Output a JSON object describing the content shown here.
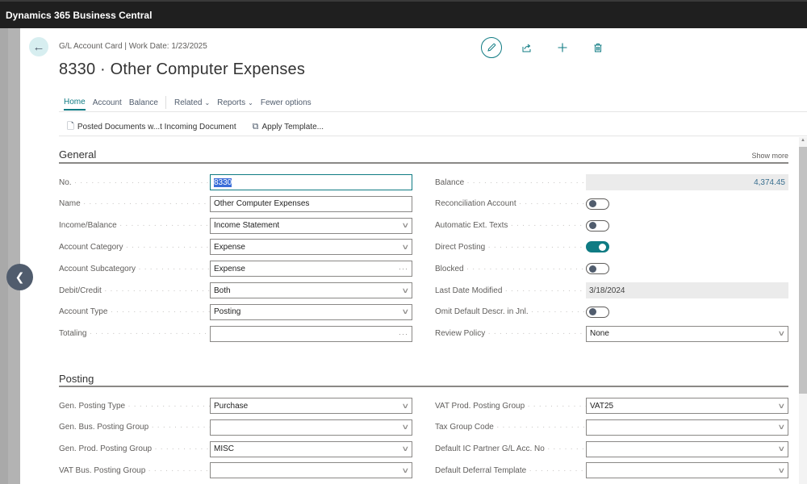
{
  "app": {
    "title": "Dynamics 365 Business Central"
  },
  "header": {
    "caption": "G/L Account Card | Work Date: 1/23/2025",
    "title": "8330 · Other Computer Expenses",
    "actions": [
      {
        "name": "edit",
        "icon": "pencil-icon"
      },
      {
        "name": "share",
        "icon": "share-icon"
      },
      {
        "name": "new",
        "icon": "plus-icon"
      },
      {
        "name": "delete",
        "icon": "trash-icon"
      }
    ]
  },
  "tabs": {
    "home": "Home",
    "account": "Account",
    "balance": "Balance",
    "related": "Related",
    "reports": "Reports",
    "fewer": "Fewer options"
  },
  "subactions": {
    "posted_docs": "Posted Documents w...t Incoming Document",
    "apply_template": "Apply Template..."
  },
  "general": {
    "title": "General",
    "show_more": "Show more",
    "left": [
      {
        "label": "No.",
        "value": "8330",
        "type": "text-selected"
      },
      {
        "label": "Name",
        "value": "Other Computer Expenses",
        "type": "text"
      },
      {
        "label": "Income/Balance",
        "value": "Income Statement",
        "type": "dropdown"
      },
      {
        "label": "Account Category",
        "value": "Expense",
        "type": "dropdown"
      },
      {
        "label": "Account Subcategory",
        "value": "Expense",
        "type": "lookup"
      },
      {
        "label": "Debit/Credit",
        "value": "Both",
        "type": "dropdown"
      },
      {
        "label": "Account Type",
        "value": "Posting",
        "type": "dropdown"
      },
      {
        "label": "Totaling",
        "value": "",
        "type": "lookup"
      }
    ],
    "right": [
      {
        "label": "Balance",
        "value": "4,374.45",
        "type": "readonly-number"
      },
      {
        "label": "Reconciliation Account",
        "value": false,
        "type": "toggle"
      },
      {
        "label": "Automatic Ext. Texts",
        "value": false,
        "type": "toggle"
      },
      {
        "label": "Direct Posting",
        "value": true,
        "type": "toggle"
      },
      {
        "label": "Blocked",
        "value": false,
        "type": "toggle"
      },
      {
        "label": "Last Date Modified",
        "value": "3/18/2024",
        "type": "readonly"
      },
      {
        "label": "Omit Default Descr. in Jnl.",
        "value": false,
        "type": "toggle"
      },
      {
        "label": "Review Policy",
        "value": "None",
        "type": "dropdown"
      }
    ]
  },
  "posting": {
    "title": "Posting",
    "left": [
      {
        "label": "Gen. Posting Type",
        "value": "Purchase",
        "type": "dropdown"
      },
      {
        "label": "Gen. Bus. Posting Group",
        "value": "",
        "type": "dropdown"
      },
      {
        "label": "Gen. Prod. Posting Group",
        "value": "MISC",
        "type": "dropdown"
      },
      {
        "label": "VAT Bus. Posting Group",
        "value": "",
        "type": "dropdown"
      }
    ],
    "right": [
      {
        "label": "VAT Prod. Posting Group",
        "value": "VAT25",
        "type": "dropdown"
      },
      {
        "label": "Tax Group Code",
        "value": "",
        "type": "dropdown"
      },
      {
        "label": "Default IC Partner G/L Acc. No",
        "value": "",
        "type": "dropdown"
      },
      {
        "label": "Default Deferral Template",
        "value": "",
        "type": "dropdown"
      }
    ]
  },
  "colors": {
    "accent": "#0f7b83",
    "topbar": "#1f1f1f",
    "toggle_off_knob": "#505c6d"
  }
}
